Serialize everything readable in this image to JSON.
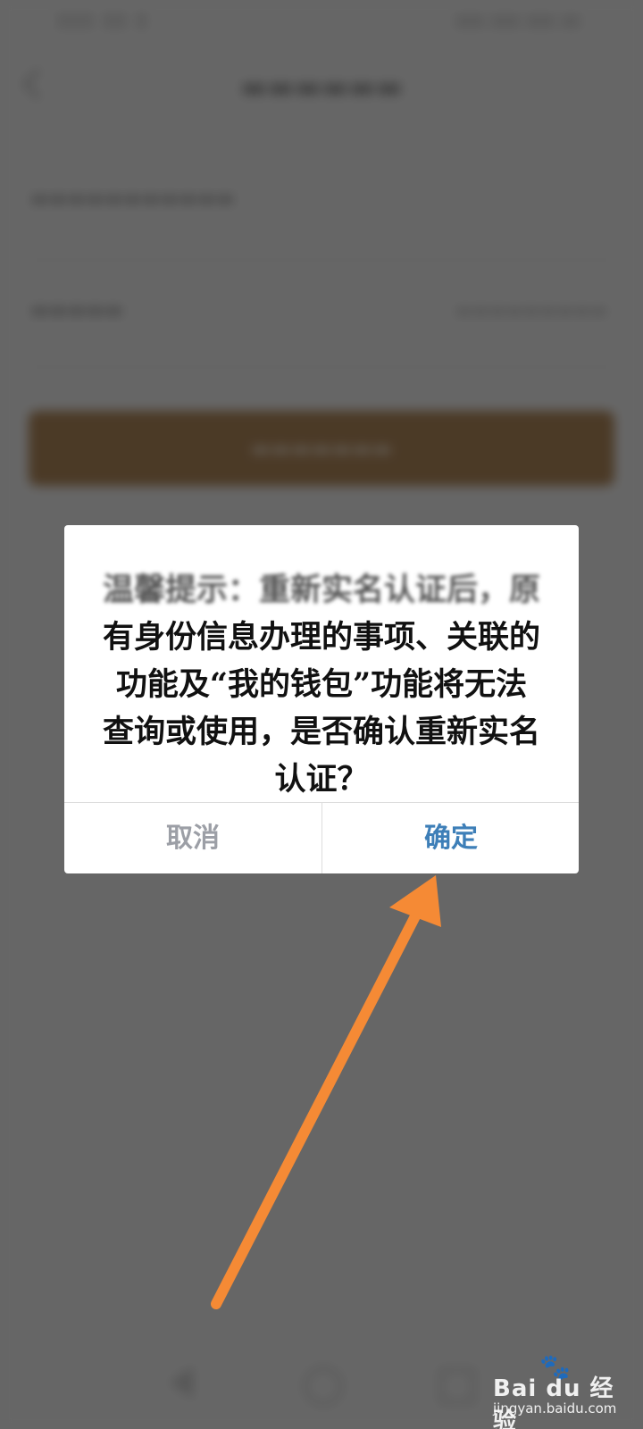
{
  "dialog": {
    "message_lines": [
      "温馨提示：重新实名认证后，原",
      "有身份信息办理的事项、关联的",
      "功能及“我的钱包”功能将无法",
      "查询或使用，是否确认重新实名",
      "认证？"
    ],
    "cancel_label": "取消",
    "confirm_label": "确定"
  },
  "colors": {
    "confirm_text": "#3e7fb8",
    "cancel_text": "#9c9fa6",
    "annotation_arrow": "#f58a35",
    "background_button": "#b38a5c"
  },
  "watermark": {
    "brand": "Bai du 经验",
    "sub": "jingyan.baidu.com"
  },
  "icons": {
    "back": "chevron-left-icon",
    "nav_back": "triangle-back-icon",
    "nav_home": "circle-home-icon",
    "nav_recent": "square-recent-icon"
  }
}
